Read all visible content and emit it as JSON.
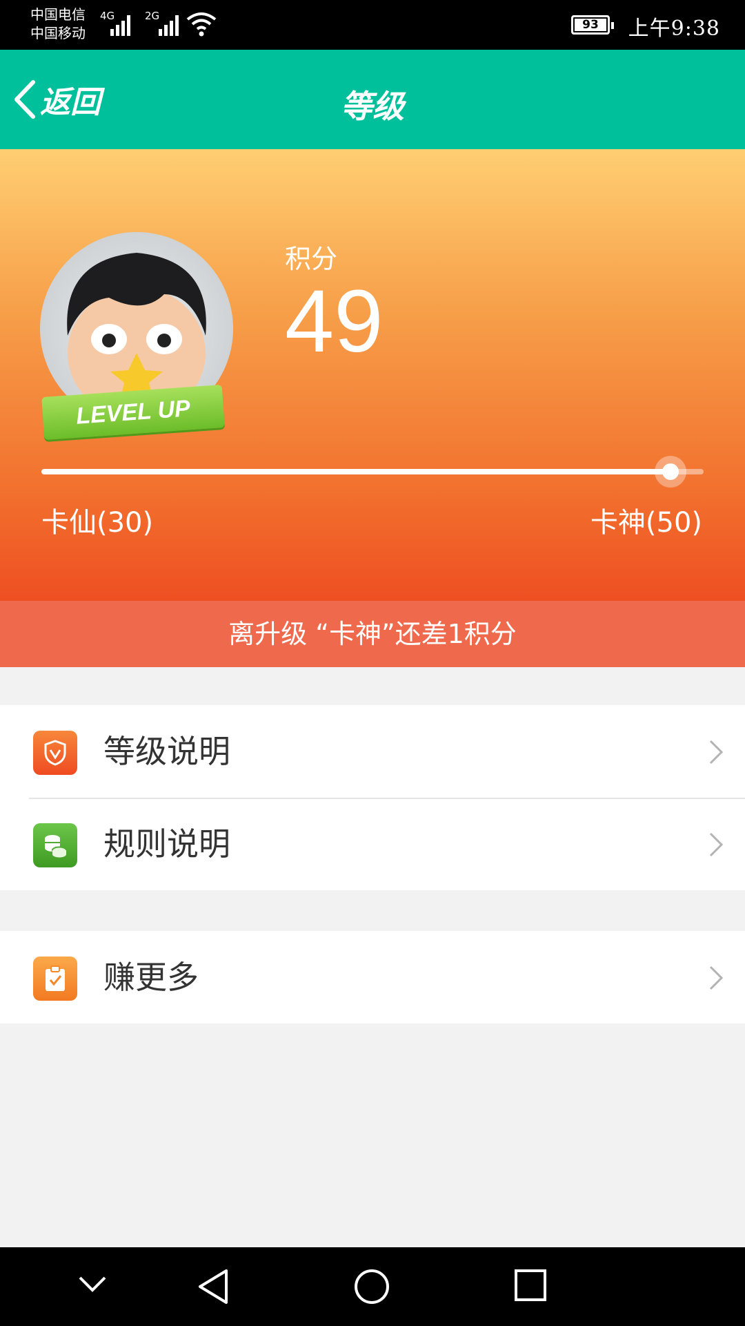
{
  "status_bar": {
    "carrier_1": "中国电信",
    "carrier_2": "中国移动",
    "network_1": "4G",
    "network_2": "2G",
    "battery": "93",
    "time": "上午9:38"
  },
  "header": {
    "back_label": "返回",
    "title": "等级"
  },
  "hero": {
    "score_label": "积分",
    "score_value": "49",
    "current_level": "卡仙(30)",
    "next_level": "卡神(50)",
    "progress_fraction": 0.95,
    "badge_text": "LEVEL UP"
  },
  "upgrade_banner": {
    "text": "离升级 “卡神”还差1积分"
  },
  "menu": {
    "items": [
      {
        "label": "等级说明",
        "icon": "shield-icon",
        "color": "#f05a2a"
      },
      {
        "label": "规则说明",
        "icon": "coins-icon",
        "color": "#4fae32"
      },
      {
        "label": "赚更多",
        "icon": "clipboard-check-icon",
        "color": "#f5892a"
      }
    ]
  },
  "colors": {
    "accent": "#00c09c",
    "banner": "#ef6a4d"
  }
}
